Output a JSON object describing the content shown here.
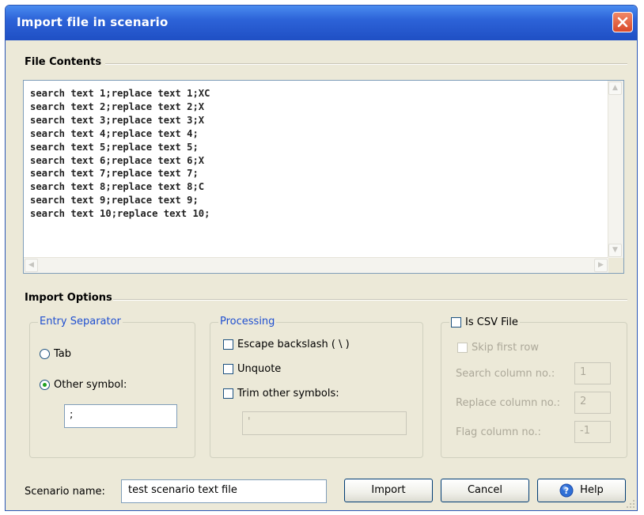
{
  "window": {
    "title": "Import file in scenario"
  },
  "file_contents": {
    "label": "File Contents",
    "lines": [
      "search text 1;replace text 1;XC",
      "search text 2;replace text 2;X",
      "search text 3;replace text 3;X",
      "search text 4;replace text 4;",
      "search text 5;replace text 5;",
      "search text 6;replace text 6;X",
      "search text 7;replace text 7;",
      "search text 8;replace text 8;C",
      "search text 9;replace text 9;",
      "search text 10;replace text 10;"
    ]
  },
  "import_options": {
    "label": "Import Options",
    "entry_separator": {
      "label": "Entry Separator",
      "tab_label": "Tab",
      "other_label": "Other symbol:",
      "selected": "other",
      "other_value": ";"
    },
    "processing": {
      "label": "Processing",
      "escape_label": "Escape backslash ( \\ )",
      "escape_checked": false,
      "unquote_label": "Unquote",
      "unquote_checked": false,
      "trim_label": "Trim other symbols:",
      "trim_checked": false,
      "trim_value": "'"
    },
    "csv": {
      "label": "Is CSV File",
      "checked": false,
      "skip_label": "Skip first row",
      "search_col_label": "Search column no.:",
      "search_col_value": "1",
      "replace_col_label": "Replace column no.:",
      "replace_col_value": "2",
      "flag_col_label": "Flag column no.:",
      "flag_col_value": "-1"
    }
  },
  "footer": {
    "scenario_label": "Scenario name:",
    "scenario_value": "test scenario text file",
    "import_label": "Import",
    "cancel_label": "Cancel",
    "help_label": "Help"
  },
  "colors": {
    "titlebar": "#2d63d8",
    "accent_text": "#1f4fd0",
    "dialog_bg": "#ece9d8",
    "close": "#d9492a"
  },
  "icons": {
    "close": "close-icon",
    "help": "help-icon"
  }
}
